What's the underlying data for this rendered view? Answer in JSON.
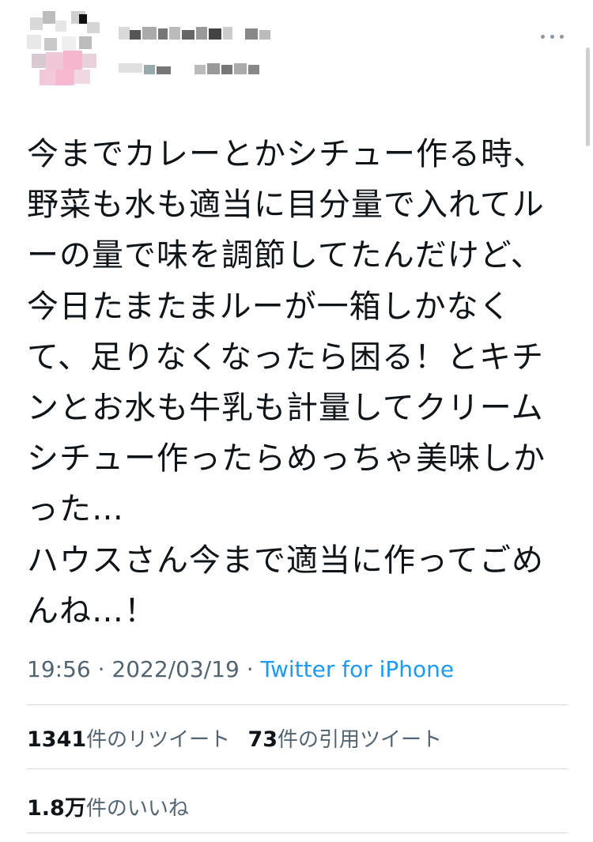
{
  "tweet": {
    "lines": [
      "今までカレーとかシチュー作る時、",
      "野菜も水も適当に目分量で入れてル",
      "ーの量で味を調節してたんだけど、",
      "今日たまたまルーが一箱しかなく",
      "て、足りなくなったら困る！とキチ",
      "ンとお水も牛乳も計量してクリーム",
      "シチュー作ったらめっちゃ美味しか",
      "った…",
      "ハウスさん今まで適当に作ってごめ",
      "んね…！"
    ]
  },
  "meta": {
    "time": "19:56",
    "separator1": " · ",
    "date": "2022/03/19",
    "separator2": " · ",
    "source": "Twitter for iPhone"
  },
  "stats": {
    "retweets_count": "1341",
    "retweets_label": "件のリツイート",
    "quotes_count": "73",
    "quotes_label": "件の引用ツイート",
    "likes_count": "1.8万",
    "likes_label": "件のいいね"
  },
  "icons": {
    "more": "more-options-icon"
  },
  "colors": {
    "link": "#1d9bf0",
    "secondary_text": "#536471",
    "divider": "#cfd9de"
  }
}
